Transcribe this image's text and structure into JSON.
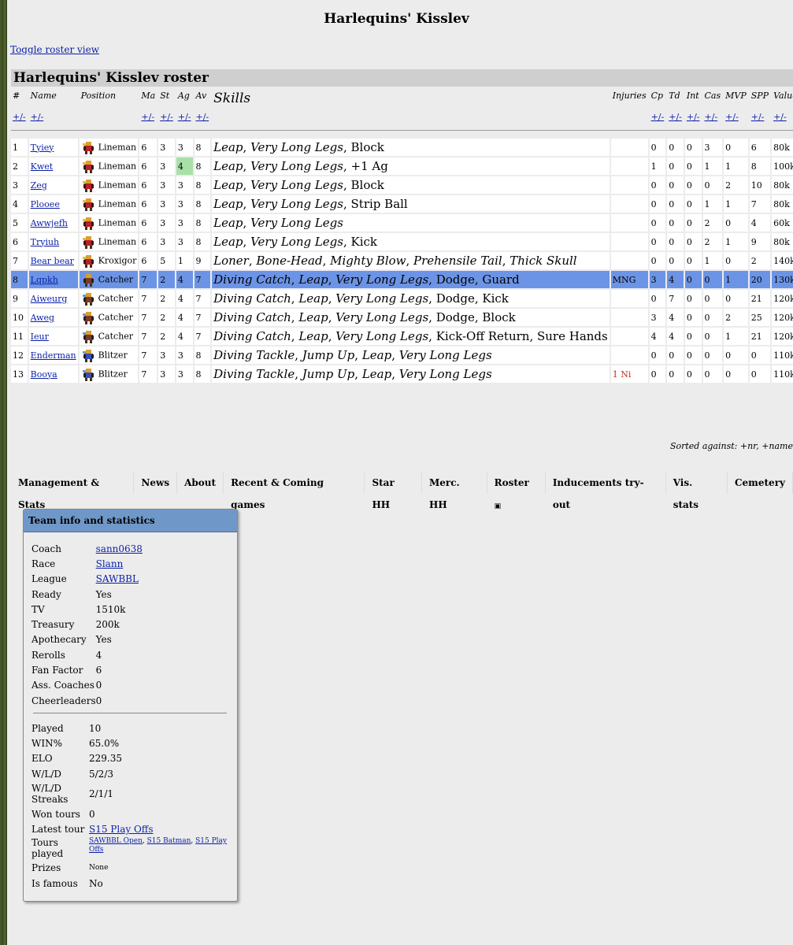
{
  "title": "Harlequins' Kisslev",
  "toggle_label": "Toggle roster view",
  "roster_title": "Harlequins' Kisslev roster",
  "columns": [
    "#",
    "Name",
    "Position",
    "Ma",
    "St",
    "Ag",
    "Av",
    "Skills",
    "Injuries",
    "Cp",
    "Td",
    "Int",
    "Cas",
    "MVP",
    "SPP",
    "Value"
  ],
  "sort_label": "+/-",
  "players": [
    {
      "nr": "1",
      "name": "Tyiey",
      "pos": "Lineman",
      "ma": "6",
      "st": "3",
      "ag": "3",
      "av": "8",
      "skills_i": [
        "Leap",
        "Very Long Legs"
      ],
      "skills_n": [
        "Block"
      ],
      "inj": "",
      "cp": "0",
      "td": "0",
      "int": "0",
      "cas": "3",
      "mvp": "0",
      "spp": "6",
      "value": "80k"
    },
    {
      "nr": "2",
      "name": "Kwet",
      "pos": "Lineman",
      "ma": "6",
      "st": "3",
      "ag": "4",
      "av": "8",
      "skills_i": [
        "Leap",
        "Very Long Legs"
      ],
      "skills_n": [
        "+1 Ag"
      ],
      "inj": "",
      "cp": "1",
      "td": "0",
      "int": "0",
      "cas": "1",
      "mvp": "1",
      "spp": "8",
      "value": "100k"
    },
    {
      "nr": "3",
      "name": "Zeg",
      "pos": "Lineman",
      "ma": "6",
      "st": "3",
      "ag": "3",
      "av": "8",
      "skills_i": [
        "Leap",
        "Very Long Legs"
      ],
      "skills_n": [
        "Block"
      ],
      "inj": "",
      "cp": "0",
      "td": "0",
      "int": "0",
      "cas": "0",
      "mvp": "2",
      "spp": "10",
      "value": "80k"
    },
    {
      "nr": "4",
      "name": "Plooee",
      "pos": "Lineman",
      "ma": "6",
      "st": "3",
      "ag": "3",
      "av": "8",
      "skills_i": [
        "Leap",
        "Very Long Legs"
      ],
      "skills_n": [
        "Strip Ball"
      ],
      "inj": "",
      "cp": "0",
      "td": "0",
      "int": "0",
      "cas": "1",
      "mvp": "1",
      "spp": "7",
      "value": "80k"
    },
    {
      "nr": "5",
      "name": "Awwjefh",
      "pos": "Lineman",
      "ma": "6",
      "st": "3",
      "ag": "3",
      "av": "8",
      "skills_i": [
        "Leap",
        "Very Long Legs"
      ],
      "skills_n": [],
      "inj": "",
      "cp": "0",
      "td": "0",
      "int": "0",
      "cas": "2",
      "mvp": "0",
      "spp": "4",
      "value": "60k"
    },
    {
      "nr": "6",
      "name": "Tryiuh",
      "pos": "Lineman",
      "ma": "6",
      "st": "3",
      "ag": "3",
      "av": "8",
      "skills_i": [
        "Leap",
        "Very Long Legs"
      ],
      "skills_n": [
        "Kick"
      ],
      "inj": "",
      "cp": "0",
      "td": "0",
      "int": "0",
      "cas": "2",
      "mvp": "1",
      "spp": "9",
      "value": "80k"
    },
    {
      "nr": "7",
      "name": "Bear bear",
      "pos": "Kroxigor",
      "ma": "6",
      "st": "5",
      "ag": "1",
      "av": "9",
      "skills_i": [
        "Loner",
        "Bone-Head",
        "Mighty Blow",
        "Prehensile Tail",
        "Thick Skull"
      ],
      "skills_n": [],
      "inj": "",
      "cp": "0",
      "td": "0",
      "int": "0",
      "cas": "1",
      "mvp": "0",
      "spp": "2",
      "value": "140k"
    },
    {
      "nr": "8",
      "name": "Lqpkh",
      "pos": "Catcher",
      "ma": "7",
      "st": "2",
      "ag": "4",
      "av": "7",
      "skills_i": [
        "Diving Catch",
        "Leap",
        "Very Long Legs"
      ],
      "skills_n": [
        "Dodge",
        "Guard"
      ],
      "inj": "MNG",
      "cp": "3",
      "td": "4",
      "int": "0",
      "cas": "0",
      "mvp": "1",
      "spp": "20",
      "value": "130k"
    },
    {
      "nr": "9",
      "name": "Aiweurg",
      "pos": "Catcher",
      "ma": "7",
      "st": "2",
      "ag": "4",
      "av": "7",
      "skills_i": [
        "Diving Catch",
        "Leap",
        "Very Long Legs"
      ],
      "skills_n": [
        "Dodge",
        "Kick"
      ],
      "inj": "",
      "cp": "0",
      "td": "7",
      "int": "0",
      "cas": "0",
      "mvp": "0",
      "spp": "21",
      "value": "120k"
    },
    {
      "nr": "10",
      "name": "Aweg",
      "pos": "Catcher",
      "ma": "7",
      "st": "2",
      "ag": "4",
      "av": "7",
      "skills_i": [
        "Diving Catch",
        "Leap",
        "Very Long Legs"
      ],
      "skills_n": [
        "Dodge",
        "Block"
      ],
      "inj": "",
      "cp": "3",
      "td": "4",
      "int": "0",
      "cas": "0",
      "mvp": "2",
      "spp": "25",
      "value": "120k"
    },
    {
      "nr": "11",
      "name": "Ieur",
      "pos": "Catcher",
      "ma": "7",
      "st": "2",
      "ag": "4",
      "av": "7",
      "skills_i": [
        "Diving Catch",
        "Leap",
        "Very Long Legs"
      ],
      "skills_n": [
        "Kick-Off Return",
        "Sure Hands"
      ],
      "inj": "",
      "cp": "4",
      "td": "4",
      "int": "0",
      "cas": "0",
      "mvp": "1",
      "spp": "21",
      "value": "120k"
    },
    {
      "nr": "12",
      "name": "Enderman",
      "pos": "Blitzer",
      "ma": "7",
      "st": "3",
      "ag": "3",
      "av": "8",
      "skills_i": [
        "Diving Tackle",
        "Jump Up",
        "Leap",
        "Very Long Legs"
      ],
      "skills_n": [],
      "inj": "",
      "cp": "0",
      "td": "0",
      "int": "0",
      "cas": "0",
      "mvp": "0",
      "spp": "0",
      "value": "110k"
    },
    {
      "nr": "13",
      "name": "Booya",
      "pos": "Blitzer",
      "ma": "7",
      "st": "3",
      "ag": "3",
      "av": "8",
      "skills_i": [
        "Diving Tackle",
        "Jump Up",
        "Leap",
        "Very Long Legs"
      ],
      "skills_n": [],
      "inj": "1 Ni",
      "cp": "0",
      "td": "0",
      "int": "0",
      "cas": "0",
      "mvp": "0",
      "spp": "0",
      "value": "110k"
    }
  ],
  "selected_row": 8,
  "sorted_text": "Sorted against: +nr, +name",
  "tabs": [
    "Management & Stats",
    "News",
    "About",
    "Recent & Coming games",
    "Star HH",
    "Merc. HH",
    "Roster",
    "Inducements try-out",
    "Vis. stats",
    "Cemetery"
  ],
  "panel_title": "Team info and statistics",
  "info1": [
    {
      "k": "Coach",
      "v": "sann0638",
      "link": true
    },
    {
      "k": "Race",
      "v": "Slann",
      "link": true
    },
    {
      "k": "League",
      "v": "SAWBBL",
      "link": true
    },
    {
      "k": "Ready",
      "v": "Yes"
    },
    {
      "k": "TV",
      "v": "1510k"
    },
    {
      "k": "Treasury",
      "v": "200k"
    },
    {
      "k": "Apothecary",
      "v": "Yes"
    },
    {
      "k": "Rerolls",
      "v": "4"
    },
    {
      "k": "Fan Factor",
      "v": "6"
    },
    {
      "k": "Ass. Coaches",
      "v": "0"
    },
    {
      "k": "Cheerleaders",
      "v": "0"
    }
  ],
  "info2": {
    "played_k": "Played",
    "played_v": "10",
    "win_k": "WIN%",
    "win_v": "65.0%",
    "elo_k": "ELO",
    "elo_v": "229.35",
    "wld_k": "W/L/D",
    "wld_v": "5/2/3",
    "streak_k1": "W/L/D",
    "streak_k2": "Streaks",
    "streak_v": "2/1/1",
    "won_k": "Won tours",
    "won_v": "0",
    "latest_k": "Latest tour",
    "latest_v": "S15 Play Offs",
    "tours_k": "Tours played",
    "tours_v1": "SAWBBL Open",
    "tours_v2": "S15 Batman",
    "tours_v3a": "S15 Play",
    "tours_v3b": "Offs",
    "prizes_k": "Prizes",
    "prizes_v": "None",
    "famous_k": "Is famous",
    "famous_v": "No"
  },
  "colors": {
    "selected_row": "#6c94e6",
    "panel_header": "#6f98c8",
    "link": "#0b1fa8",
    "highlight_stat": "#a8e0a8",
    "injury": "#c0301a"
  }
}
